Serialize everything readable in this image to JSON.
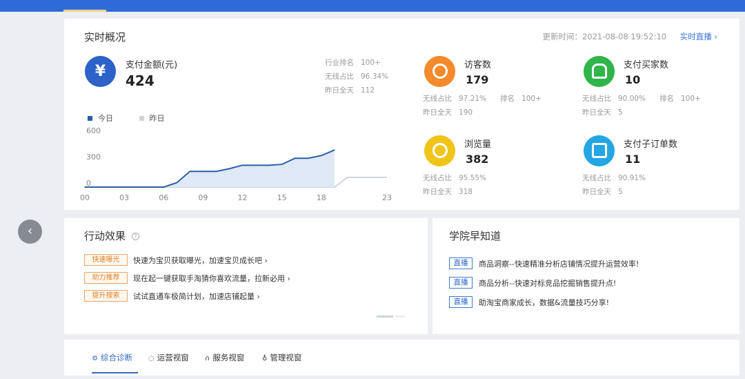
{
  "overview": {
    "title": "实时概况",
    "update_label": "更新时间：",
    "update_time": "2021-08-08 19:52:10",
    "live_label": "实时直播",
    "live_chevron": "›",
    "pay_amount": {
      "icon": "yen-icon",
      "icon_glyph": "¥",
      "label": "支付金额(元)",
      "value": "424",
      "rank_label": "行业排名",
      "rank_value": "100+",
      "wireless_label": "无线占比",
      "wireless_value": "96.34%",
      "yesterday_label": "昨日全天",
      "yesterday_value": "112"
    },
    "legend": {
      "today": "今日",
      "yesterday": "昨日"
    },
    "metrics": {
      "visitors": {
        "label": "访客数",
        "value": "179",
        "wireless_label": "无线占比",
        "wireless_value": "97.21%",
        "rank_label": "排名",
        "rank_value": "100+",
        "yesterday_label": "昨日全天",
        "yesterday_value": "190",
        "color": "#f38a2b",
        "icon": "footprint-icon"
      },
      "buyers": {
        "label": "支付买家数",
        "value": "10",
        "wireless_label": "无线占比",
        "wireless_value": "90.00%",
        "rank_label": "排名",
        "rank_value": "100+",
        "yesterday_label": "昨日全天",
        "yesterday_value": "5",
        "color": "#2fb54a",
        "icon": "users-icon"
      },
      "pageviews": {
        "label": "浏览量",
        "value": "382",
        "wireless_label": "无线占比",
        "wireless_value": "95.55%",
        "yesterday_label": "昨日全天",
        "yesterday_value": "318",
        "color": "#f0c419",
        "icon": "eye-icon"
      },
      "suborders": {
        "label": "支付子订单数",
        "value": "11",
        "wireless_label": "无线占比",
        "wireless_value": "90.91%",
        "yesterday_label": "昨日全天",
        "yesterday_value": "5",
        "color": "#23a6e3",
        "icon": "clipboard-icon"
      }
    }
  },
  "chart_data": {
    "type": "line",
    "x": [
      "00",
      "01",
      "02",
      "03",
      "04",
      "05",
      "06",
      "07",
      "08",
      "09",
      "10",
      "11",
      "12",
      "13",
      "14",
      "15",
      "16",
      "17",
      "18",
      "19",
      "20",
      "21",
      "22",
      "23"
    ],
    "xticks": [
      "00",
      "03",
      "06",
      "09",
      "12",
      "15",
      "18",
      "23"
    ],
    "yticks": [
      "600",
      "300",
      "0"
    ],
    "ylim": [
      0,
      600
    ],
    "series": [
      {
        "name": "今日",
        "color": "#2c5ea8",
        "values": [
          0,
          0,
          0,
          0,
          0,
          0,
          0,
          50,
          180,
          180,
          180,
          210,
          250,
          250,
          250,
          260,
          330,
          330,
          360,
          424
        ]
      },
      {
        "name": "昨日",
        "color": "#cfd3da",
        "values": [
          0,
          0,
          0,
          0,
          0,
          0,
          0,
          0,
          0,
          0,
          0,
          0,
          0,
          0,
          0,
          0,
          0,
          0,
          0,
          0,
          112,
          112,
          112,
          112
        ]
      }
    ],
    "legend": "top-left",
    "grid": false
  },
  "action": {
    "title": "行动效果",
    "help_icon": "question-circle-icon",
    "help_glyph": "?",
    "items": [
      {
        "tag": "快速曝光",
        "text": "快速为宝贝获取曝光，加速宝贝成长吧 ›"
      },
      {
        "tag": "助力推荐",
        "text": "现在起一键获取手淘猜你喜欢流量，拉新必用 ›"
      },
      {
        "tag": "提升搜索",
        "text": "试试直通车极简计划，加速店铺起量 ›"
      }
    ]
  },
  "school": {
    "title": "学院早知道",
    "items": [
      {
        "badge": "直播",
        "text": "商品洞察--快速精准分析店铺情况提升运营效率!"
      },
      {
        "badge": "直播",
        "text": "商品分析--快速对标竞品挖掘销售提升点!"
      },
      {
        "badge": "直播",
        "text": "助淘宝商家成长，数据&流量技巧分享!"
      }
    ]
  },
  "tabs": [
    {
      "icon": "diagnosis-icon",
      "glyph": "⚙",
      "label": "综合诊断"
    },
    {
      "icon": "ops-window-icon",
      "glyph": "◌",
      "label": "运营视窗"
    },
    {
      "icon": "headset-icon",
      "glyph": "∩",
      "label": "服务视窗"
    },
    {
      "icon": "manage-icon",
      "glyph": "♁",
      "label": "管理视窗"
    }
  ],
  "nav": {
    "prev_glyph": "‹"
  }
}
